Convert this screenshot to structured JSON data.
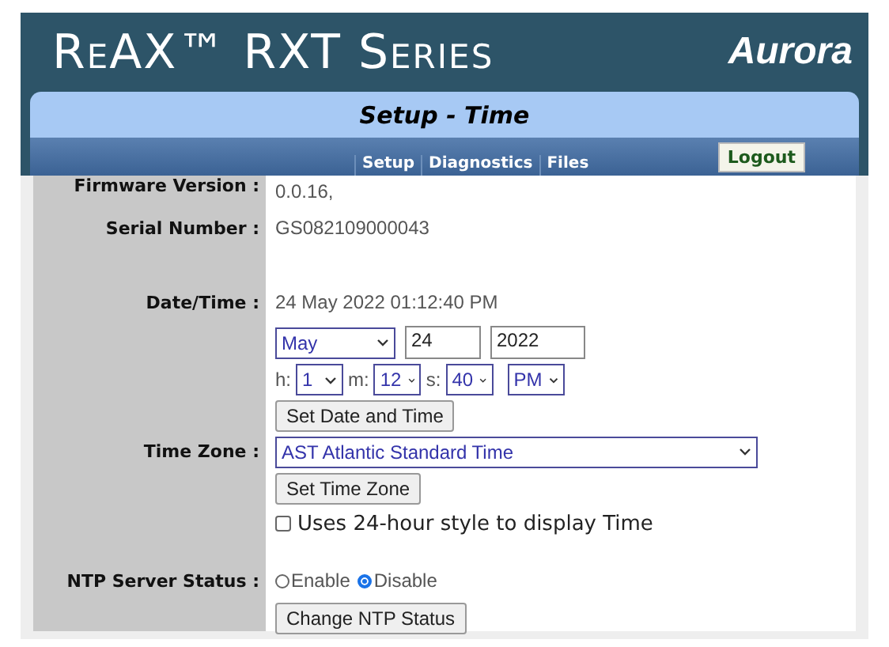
{
  "header": {
    "brand": "ReAX™ RXT Series",
    "logo": "Aurora",
    "page_title": "Setup - Time"
  },
  "nav": [
    {
      "label": "Setup"
    },
    {
      "label": "Diagnostics"
    },
    {
      "label": "Files"
    }
  ],
  "logout": "Logout",
  "firmware": {
    "label": "Firmware Version :",
    "value": "0.0.16,"
  },
  "serial": {
    "label": "Serial Number :",
    "value": "GS082109000043"
  },
  "datetime": {
    "label": "Date/Time :",
    "value": "24 May 2022 01:12:40 PM",
    "month": "May",
    "day": "24",
    "year": "2022",
    "time": [
      {
        "label": "h:",
        "value": "1"
      },
      {
        "label": "m:",
        "value": "12"
      },
      {
        "label": "s:",
        "value": "40"
      }
    ],
    "ampm": "PM",
    "button": "Set Date and Time"
  },
  "timezone": {
    "label": "Time Zone :",
    "value": "AST Atlantic Standard Time",
    "button": "Set Time Zone",
    "checkbox": {
      "label": "Uses 24-hour style to display Time",
      "checked": false
    }
  },
  "ntp": {
    "label": "NTP Server Status :",
    "options": [
      {
        "label": "Enable",
        "selected": false
      },
      {
        "label": "Disable",
        "selected": true
      }
    ],
    "button": "Change NTP Status"
  }
}
